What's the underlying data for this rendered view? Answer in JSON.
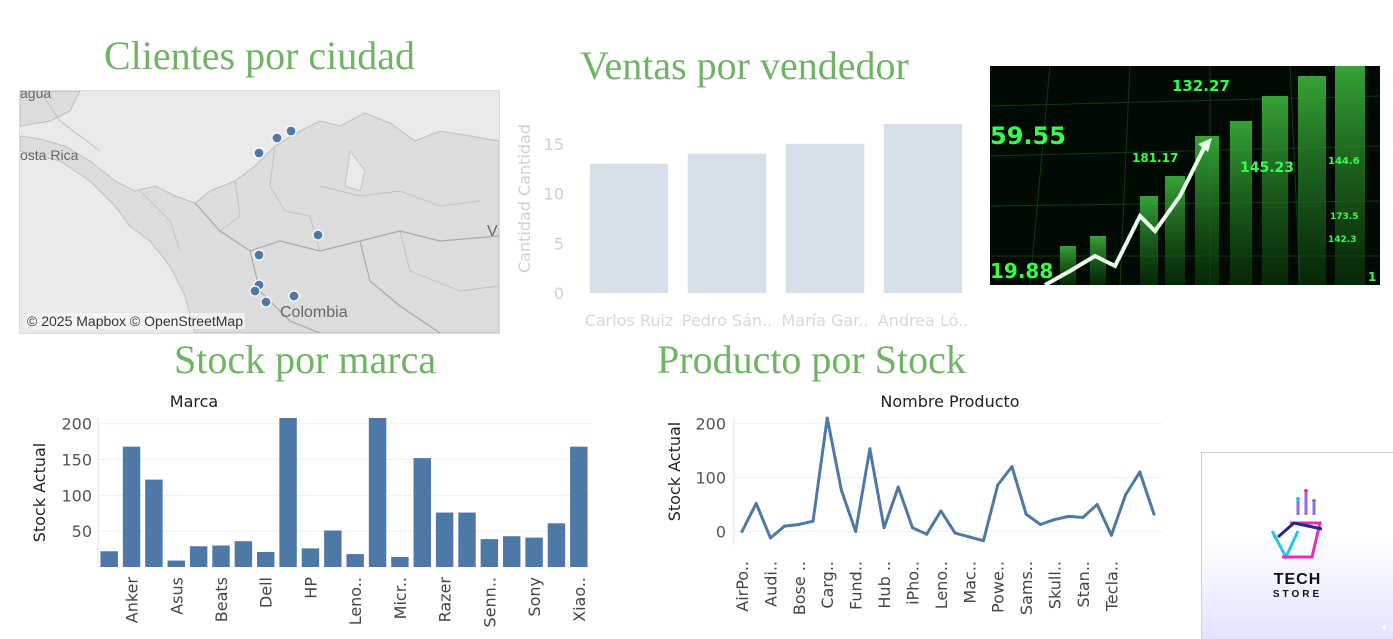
{
  "titles": {
    "map": "Clientes por ciudad",
    "sales": "Ventas por vendedor",
    "brand": "Stock por marca",
    "product": "Producto por Stock"
  },
  "map": {
    "labels": {
      "costa_rica": "osta Rica",
      "colombia": "Colombia",
      "top": "agua",
      "edge": "V"
    },
    "credit": "© 2025 Mapbox © OpenStreetMap"
  },
  "stock_image": {
    "labels": [
      "132.27",
      "59.55",
      "181.17",
      "145.23",
      "19.88",
      "144.6",
      "173.5",
      "142.3",
      "1"
    ]
  },
  "logo": {
    "line1": "TECH",
    "line2": "STORE"
  },
  "chart_data": [
    {
      "type": "bar",
      "title": "",
      "ylabel": "Cantidad Cantidad",
      "xlabel": "",
      "categories": [
        "Carlos Ruiz",
        "Pedro Sán..",
        "María Gar..",
        "Andrea Ló.."
      ],
      "values": [
        13,
        14,
        15,
        17
      ],
      "ylim": [
        0,
        19
      ],
      "yticks": [
        0,
        5,
        10,
        15
      ],
      "color": "#d5dfe9"
    },
    {
      "type": "bar",
      "title": "Marca",
      "ylabel": "Stock Actual",
      "xlabel": "",
      "categories": [
        "",
        "Anker",
        "",
        "Asus",
        "",
        "Beats",
        "",
        "Dell",
        "",
        "HP",
        "",
        "Leno..",
        "",
        "Micr..",
        "",
        "Razer",
        "",
        "Senn..",
        "",
        "Sony",
        "",
        "Xiao.."
      ],
      "values": [
        22,
        168,
        122,
        9,
        29,
        30,
        36,
        21,
        208,
        26,
        51,
        18,
        208,
        14,
        152,
        76,
        76,
        39,
        43,
        41,
        61,
        168
      ],
      "ylim": [
        0,
        208
      ],
      "yticks": [
        50,
        100,
        150,
        200
      ],
      "color": "#4e79a7"
    },
    {
      "type": "line",
      "title": "Nombre Producto",
      "ylabel": "Stock Actual",
      "xlabel": "",
      "categories": [
        "AirPo..",
        "",
        "Audi..",
        "",
        "Bose ..",
        "",
        "Carg..",
        "",
        "Fund..",
        "",
        "Hub ..",
        "",
        "iPho..",
        "",
        "Leno..",
        "",
        "Mac..",
        "",
        "Powe..",
        "",
        "Sams..",
        "",
        "Skull..",
        "",
        "Stan..",
        "",
        "Tecla..",
        ""
      ],
      "values": [
        0,
        52,
        -12,
        10,
        13,
        19,
        210,
        76,
        0,
        153,
        7,
        82,
        7,
        -5,
        38,
        -3,
        -10,
        -17,
        86,
        120,
        32,
        13,
        22,
        28,
        26,
        50,
        -7,
        68,
        110,
        32
      ],
      "ylim": [
        -25,
        210
      ],
      "yticks": [
        0,
        100,
        200
      ],
      "color": "#4e79a7"
    }
  ]
}
